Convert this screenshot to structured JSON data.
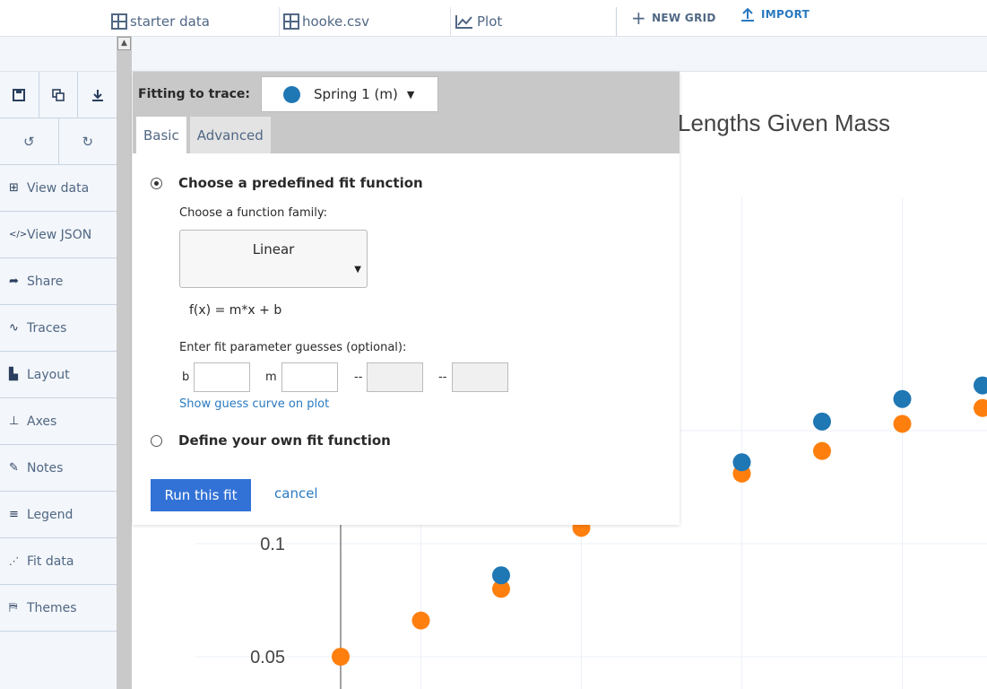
{
  "tabs": [
    {
      "label": "starter data",
      "icon": "grid-icon"
    },
    {
      "label": "hooke.csv",
      "icon": "grid-icon"
    },
    {
      "label": "Plot",
      "icon": "chart-line-icon"
    }
  ],
  "toolbar": {
    "new_grid": "NEW GRID",
    "import": "IMPORT"
  },
  "sidebar": {
    "tools_row1": [
      "save-icon",
      "copy-icon",
      "download-icon"
    ],
    "tools_row2": [
      "undo-icon",
      "redo-icon"
    ],
    "items": [
      {
        "label": "View data",
        "icon": "grid-icon"
      },
      {
        "label": "View JSON",
        "icon": "code-icon"
      },
      {
        "label": "Share",
        "icon": "share-icon"
      },
      {
        "label": "Traces",
        "icon": "traces-icon"
      },
      {
        "label": "Layout",
        "icon": "layout-icon"
      },
      {
        "label": "Axes",
        "icon": "axes-icon"
      },
      {
        "label": "Notes",
        "icon": "pencil-icon"
      },
      {
        "label": "Legend",
        "icon": "legend-icon"
      },
      {
        "label": "Fit data",
        "icon": "fit-icon"
      },
      {
        "label": "Themes",
        "icon": "paint-roller-icon"
      }
    ]
  },
  "fit_panel": {
    "fitting_label": "Fitting to trace:",
    "trace_selected": "Spring 1 (m)",
    "trace_color": "#1f77b4",
    "tab_basic": "Basic",
    "tab_advanced": "Advanced",
    "predefined_label": "Choose a predefined fit function",
    "family_label": "Choose a function family:",
    "family_value": "Linear",
    "formula": "f(x) = m*x + b",
    "guess_label": "Enter fit parameter guesses (optional):",
    "params": [
      "b",
      "m",
      "--",
      "--"
    ],
    "show_guess_link": "Show guess curve on plot",
    "custom_label": "Define your own fit function",
    "run_button": "Run this fit",
    "cancel_link": "cancel"
  },
  "plot": {
    "title_visible": "Lengths Given Mass",
    "y_ticks": [
      "0.1",
      "0.05"
    ]
  },
  "chart_data": {
    "type": "scatter",
    "title": "Lengths Given Mass",
    "ylabel": "",
    "xlabel": "",
    "y_ticks": [
      0.05,
      0.1
    ],
    "series": [
      {
        "name": "Spring 1 (m)",
        "color": "#1f77b4",
        "points": [
          [
            2,
            0.086
          ],
          [
            5,
            0.136
          ],
          [
            6,
            0.154
          ],
          [
            7,
            0.164
          ],
          [
            8,
            0.17
          ]
        ]
      },
      {
        "color": "#ff7f0e",
        "points": [
          [
            0,
            0.05
          ],
          [
            1,
            0.066
          ],
          [
            2,
            0.08
          ],
          [
            3,
            0.107
          ],
          [
            5,
            0.131
          ],
          [
            6,
            0.141
          ],
          [
            7,
            0.153
          ],
          [
            8,
            0.16
          ]
        ]
      }
    ]
  }
}
